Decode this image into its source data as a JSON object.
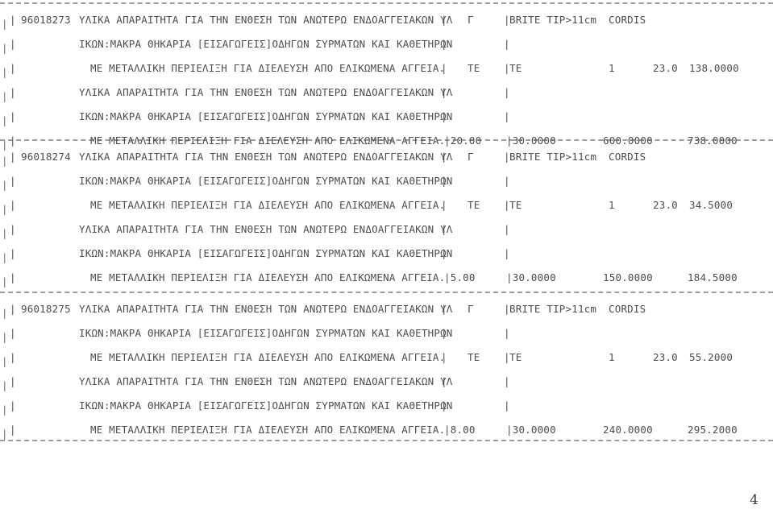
{
  "document": {
    "page_number": "4",
    "pipe_glyph": "|",
    "records": [
      {
        "code": "96018273",
        "lines": [
          {
            "type": "header",
            "pipe": "|",
            "code": "96018273",
            "description": "ΥΛΙΚΑ ΑΠΑΡΑΙΤΗΤΑ ΓΙΑ ΤΗΝ ΕΝΘΕΣΗ ΤΩΝ ΑΝΩΤΕΡΩ ΕΝΔΟΑΓΓΕΙΑΚΩΝ ΥΛ",
            "pipe2": "|",
            "category": "Γ",
            "pipe3": "|",
            "product": "BRITE TIP>11cm",
            "manufacturer": "CORDIS"
          },
          {
            "type": "desc",
            "pipe": "|",
            "description": "ΙΚΩΝ:ΜΑΚΡΑ ΘΗΚΑΡΙΑ [ΕΙΣΑΓΩΓΕΙΣ]ΟΔΗΓΩΝ ΣΥΡΜΑΤΩΝ ΚΑΙ ΚΑΘΕΤΗΡΩΝ",
            "pipe2": "|",
            "pipe3": "|"
          },
          {
            "type": "units",
            "pipe": "|",
            "description": "ΜΕ ΜΕΤΑΛΛΙΚΗ ΠΕΡΙΕΛΙΞΗ ΓΙΑ ΔΙΕΛΕΥΣΗ ΑΠΟ ΕΛΙΚΩΜΕΝΑ ΑΓΓΕΙΑ.",
            "pipe2": "|",
            "unit_a": "ΤΕ",
            "pipe3": "|",
            "unit_b": "ΤΕ",
            "qty": "1",
            "price": "23.0",
            "amount": "138.0000"
          },
          {
            "type": "desc",
            "pipe": "|",
            "description": "ΥΛΙΚΑ ΑΠΑΡΑΙΤΗΤΑ ΓΙΑ ΤΗΝ ΕΝΘΕΣΗ ΤΩΝ ΑΝΩΤΕΡΩ ΕΝΔΟΑΓΓΕΙΑΚΩΝ ΥΛ",
            "pipe2": "|",
            "pipe3": "|"
          },
          {
            "type": "desc",
            "pipe": "|",
            "description": "ΙΚΩΝ:ΜΑΚΡΑ ΘΗΚΑΡΙΑ [ΕΙΣΑΓΩΓΕΙΣ]ΟΔΗΓΩΝ ΣΥΡΜΑΤΩΝ ΚΑΙ ΚΑΘΕΤΗΡΩΝ",
            "pipe2": "|",
            "pipe3": "|"
          },
          {
            "type": "totals",
            "pipe": "|",
            "description": "ΜΕ ΜΕΤΑΛΛΙΚΗ ΠΕΡΙΕΛΙΞΗ ΓΙΑ ΔΙΕΛΕΥΣΗ ΑΠΟ ΕΛΙΚΩΜΕΝΑ ΑΓΓΕΙΑ.",
            "val1": "|20.00",
            "val2": "|30.0000",
            "val3": "600.0000",
            "val4": "738.0000"
          }
        ]
      },
      {
        "code": "96018274",
        "lines": [
          {
            "type": "header",
            "pipe": "|",
            "code": "96018274",
            "description": "ΥΛΙΚΑ ΑΠΑΡΑΙΤΗΤΑ ΓΙΑ ΤΗΝ ΕΝΘΕΣΗ ΤΩΝ ΑΝΩΤΕΡΩ ΕΝΔΟΑΓΓΕΙΑΚΩΝ ΥΛ",
            "pipe2": "|",
            "category": "Γ",
            "pipe3": "|",
            "product": "BRITE TIP>11cm",
            "manufacturer": "CORDIS"
          },
          {
            "type": "desc",
            "pipe": "|",
            "description": "ΙΚΩΝ:ΜΑΚΡΑ ΘΗΚΑΡΙΑ [ΕΙΣΑΓΩΓΕΙΣ]ΟΔΗΓΩΝ ΣΥΡΜΑΤΩΝ ΚΑΙ ΚΑΘΕΤΗΡΩΝ",
            "pipe2": "|",
            "pipe3": "|"
          },
          {
            "type": "units",
            "pipe": "|",
            "description": "ΜΕ ΜΕΤΑΛΛΙΚΗ ΠΕΡΙΕΛΙΞΗ ΓΙΑ ΔΙΕΛΕΥΣΗ ΑΠΟ ΕΛΙΚΩΜΕΝΑ ΑΓΓΕΙΑ.",
            "pipe2": "|",
            "unit_a": "ΤΕ",
            "pipe3": "|",
            "unit_b": "ΤΕ",
            "qty": "1",
            "price": "23.0",
            "amount": "34.5000"
          },
          {
            "type": "desc",
            "pipe": "|",
            "description": "ΥΛΙΚΑ ΑΠΑΡΑΙΤΗΤΑ ΓΙΑ ΤΗΝ ΕΝΘΕΣΗ ΤΩΝ ΑΝΩΤΕΡΩ ΕΝΔΟΑΓΓΕΙΑΚΩΝ ΥΛ",
            "pipe2": "|",
            "pipe3": "|"
          },
          {
            "type": "desc",
            "pipe": "|",
            "description": "ΙΚΩΝ:ΜΑΚΡΑ ΘΗΚΑΡΙΑ [ΕΙΣΑΓΩΓΕΙΣ]ΟΔΗΓΩΝ ΣΥΡΜΑΤΩΝ ΚΑΙ ΚΑΘΕΤΗΡΩΝ",
            "pipe2": "|",
            "pipe3": "|"
          },
          {
            "type": "totals",
            "pipe": "|",
            "description": "ΜΕ ΜΕΤΑΛΛΙΚΗ ΠΕΡΙΕΛΙΞΗ ΓΙΑ ΔΙΕΛΕΥΣΗ ΑΠΟ ΕΛΙΚΩΜΕΝΑ ΑΓΓΕΙΑ.",
            "val1": "|5.00",
            "val2": "|30.0000",
            "val3": "150.0000",
            "val4": "184.5000"
          }
        ]
      },
      {
        "code": "96018275",
        "lines": [
          {
            "type": "header",
            "pipe": "|",
            "code": "96018275",
            "description": "ΥΛΙΚΑ ΑΠΑΡΑΙΤΗΤΑ ΓΙΑ ΤΗΝ ΕΝΘΕΣΗ ΤΩΝ ΑΝΩΤΕΡΩ ΕΝΔΟΑΓΓΕΙΑΚΩΝ ΥΛ",
            "pipe2": "|",
            "category": "Γ",
            "pipe3": "|",
            "product": "BRITE TIP>11cm",
            "manufacturer": "CORDIS"
          },
          {
            "type": "desc",
            "pipe": "|",
            "description": "ΙΚΩΝ:ΜΑΚΡΑ ΘΗΚΑΡΙΑ [ΕΙΣΑΓΩΓΕΙΣ]ΟΔΗΓΩΝ ΣΥΡΜΑΤΩΝ ΚΑΙ ΚΑΘΕΤΗΡΩΝ",
            "pipe2": "|",
            "pipe3": "|"
          },
          {
            "type": "units",
            "pipe": "|",
            "description": "ΜΕ ΜΕΤΑΛΛΙΚΗ ΠΕΡΙΕΛΙΞΗ ΓΙΑ ΔΙΕΛΕΥΣΗ ΑΠΟ ΕΛΙΚΩΜΕΝΑ ΑΓΓΕΙΑ.",
            "pipe2": "|",
            "unit_a": "ΤΕ",
            "pipe3": "|",
            "unit_b": "ΤΕ",
            "qty": "1",
            "price": "23.0",
            "amount": "55.2000"
          },
          {
            "type": "desc",
            "pipe": "|",
            "description": "ΥΛΙΚΑ ΑΠΑΡΑΙΤΗΤΑ ΓΙΑ ΤΗΝ ΕΝΘΕΣΗ ΤΩΝ ΑΝΩΤΕΡΩ ΕΝΔΟΑΓΓΕΙΑΚΩΝ ΥΛ",
            "pipe2": "|",
            "pipe3": "|"
          },
          {
            "type": "desc",
            "pipe": "|",
            "description": "ΙΚΩΝ:ΜΑΚΡΑ ΘΗΚΑΡΙΑ [ΕΙΣΑΓΩΓΕΙΣ]ΟΔΗΓΩΝ ΣΥΡΜΑΤΩΝ ΚΑΙ ΚΑΘΕΤΗΡΩΝ",
            "pipe2": "|",
            "pipe3": "|"
          },
          {
            "type": "totals",
            "pipe": "|",
            "description": "ΜΕ ΜΕΤΑΛΛΙΚΗ ΠΕΡΙΕΛΙΞΗ ΓΙΑ ΔΙΕΛΕΥΣΗ ΑΠΟ ΕΛΙΚΩΜΕΝΑ ΑΓΓΕΙΑ.",
            "val1": "|8.00",
            "val2": "|30.0000",
            "val3": "240.0000",
            "val4": "295.2000"
          }
        ]
      }
    ]
  }
}
